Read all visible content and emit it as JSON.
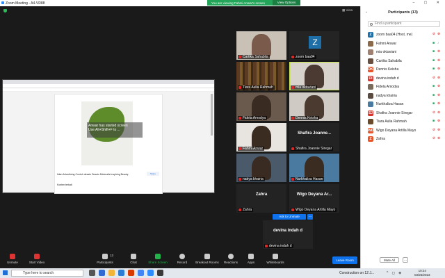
{
  "window": {
    "title": "Zoom Meeting - A4-VR88"
  },
  "share_banner": {
    "message": "You are viewing Fahmi Anwar's screen",
    "options_label": "View Options"
  },
  "view_button": "View",
  "shared_screen": {
    "overlay_line1": "Anwar has started screen",
    "overlay_line2": "Use Alt+Shift+F to ...",
    "caption": "Iklan Advertising Contoh desain Desain Minimalis Inspiring Beauty",
    "share_label": "Share",
    "konten": "Konten terkait"
  },
  "tiles": [
    {
      "name": "Cartika Sahabila",
      "kind": "face",
      "color": "#7a5a4a",
      "bg": "#c9c0b6"
    },
    {
      "name": "zoom baa04",
      "kind": "logo",
      "letter": "Z"
    },
    {
      "name": "Tiara Aulia Rahmah",
      "kind": "shelf"
    },
    {
      "name": "mia oktaviani",
      "kind": "face",
      "color": "#4a3a32",
      "bg": "#d7d2cc",
      "active": true
    },
    {
      "name": "Fidela Amodya",
      "kind": "face",
      "color": "#3a2b22",
      "bg": "#6a5a4e"
    },
    {
      "name": "Dennis Keisha",
      "kind": "face",
      "color": "#4b3a30",
      "bg": "#cfcac3"
    },
    {
      "name": "Fahmi Anwar",
      "kind": "face",
      "color": "#3b2c22",
      "bg": "#e8e4df"
    },
    {
      "name": "Shafira Joannie Siregar",
      "kind": "text",
      "display": "Shafira Joanne..."
    },
    {
      "name": "nadya khairia",
      "kind": "face",
      "color": "#3a2b22",
      "bg": "#4a5a6a"
    },
    {
      "name": "Nurkhaliza Hasan",
      "kind": "face",
      "color": "#3b2c22",
      "bg": "#4a7aa0"
    },
    {
      "name": "Zahra",
      "kind": "text",
      "display": "Zahra"
    },
    {
      "name": "Wigo Deyana Artilla Mayo",
      "kind": "text",
      "display": "Wigo Deyana Ar..."
    },
    {
      "name": "devina indah d",
      "kind": "text",
      "display": "devina indah d"
    }
  ],
  "ask_unmute": "Ask to Unmute",
  "participants": {
    "title": "Participants (13)",
    "search_placeholder": "Find a participant",
    "list": [
      {
        "name": "zoom baa04 (Host, me)",
        "initial": "Z",
        "color": "#1e6fa8",
        "video": "off",
        "mic": "off"
      },
      {
        "name": "Fahmi Anwar",
        "initial": "",
        "color": "#8a6a4a",
        "video": "on",
        "mic": "on"
      },
      {
        "name": "mia oktaviani",
        "initial": "",
        "color": "#a08070",
        "video": "on",
        "mic": "off"
      },
      {
        "name": "Cartika Sahabila",
        "initial": "",
        "color": "#6a5040",
        "video": "on",
        "mic": "off"
      },
      {
        "name": "Dennis Keisha",
        "initial": "DK",
        "color": "#e8542a",
        "video": "on",
        "mic": "off"
      },
      {
        "name": "devina indah d",
        "initial": "DI",
        "color": "#d9342b",
        "video": "off",
        "mic": "off"
      },
      {
        "name": "Fidela Amodya",
        "initial": "",
        "color": "#7a6a5a",
        "video": "on",
        "mic": "off"
      },
      {
        "name": "nadya khairia",
        "initial": "",
        "color": "#5a4a40",
        "video": "on",
        "mic": "off"
      },
      {
        "name": "Nurkhaliza Hasan",
        "initial": "",
        "color": "#4a7aa0",
        "video": "on",
        "mic": "off"
      },
      {
        "name": "Shafira Joannie Siregar",
        "initial": "SJ",
        "color": "#d9342b",
        "video": "off",
        "mic": "off"
      },
      {
        "name": "Tiara Aulia Rahmah",
        "initial": "",
        "color": "#6a4a2a",
        "video": "on",
        "mic": "off"
      },
      {
        "name": "Wigo Deyana Artilla Mayo",
        "initial": "WD",
        "color": "#e8542a",
        "video": "off",
        "mic": "off"
      },
      {
        "name": "Zahra",
        "initial": "Z",
        "color": "#e8542a",
        "video": "off",
        "mic": "off"
      }
    ],
    "mute_all": "Mute All",
    "more": "..."
  },
  "toolbar": {
    "unmute": "Unmute",
    "start_video": "Start Video",
    "participants": "Participants",
    "participants_count": "13",
    "chat": "Chat",
    "share_screen": "Share Screen",
    "record": "Record",
    "breakout": "Breakout Rooms",
    "reactions": "Reactions",
    "apps": "Apps",
    "whiteboards": "Whiteboards",
    "leave": "Leave Room"
  },
  "taskbar": {
    "search_placeholder": "Type here to search",
    "weather": "Construction on 12 J...",
    "time": "10:24",
    "date": "03/25/2023"
  },
  "colors": {
    "accent": "#0e72ed",
    "share_green": "#23a55a",
    "muted_red": "#e02828"
  }
}
